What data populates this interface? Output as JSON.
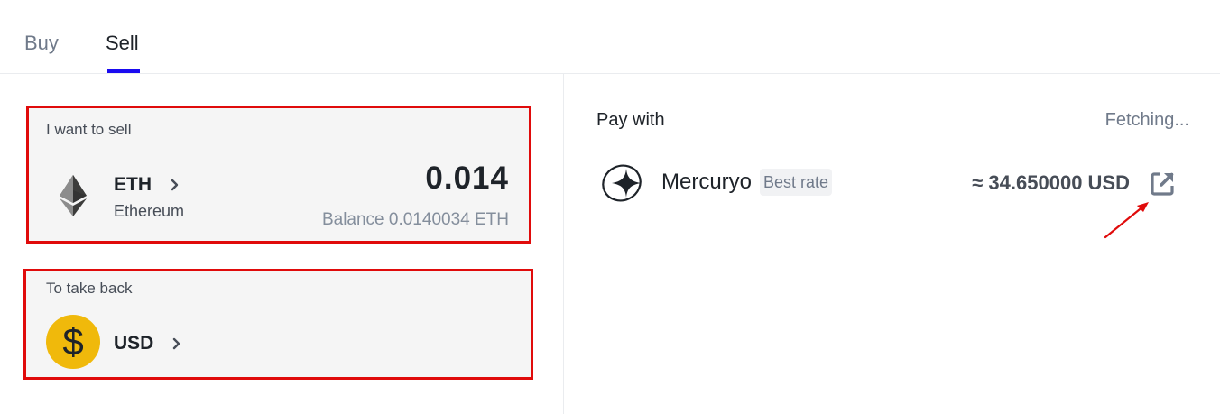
{
  "tabs": {
    "buy_label": "Buy",
    "sell_label": "Sell",
    "active": "Sell"
  },
  "sell_card": {
    "label": "I want to sell",
    "asset_code": "ETH",
    "asset_name": "Ethereum",
    "asset_icon": "ethereum-icon",
    "amount": "0.014",
    "balance": "Balance 0.0140034 ETH"
  },
  "receive_card": {
    "label": "To take back",
    "asset_code": "USD",
    "asset_icon": "dollar-icon"
  },
  "pay_with": {
    "label": "Pay with",
    "status": "Fetching...",
    "provider": {
      "name": "Mercuryo",
      "badge": "Best rate",
      "rate": "≈ 34.650000 USD",
      "logo_icon": "mercuryo-logo-icon",
      "action_icon": "external-link-icon"
    }
  },
  "colors": {
    "accent": "#1a0bf0",
    "highlight_border": "#e00b0b",
    "usd_coin": "#f0b90b",
    "card_bg": "#f5f5f5"
  }
}
